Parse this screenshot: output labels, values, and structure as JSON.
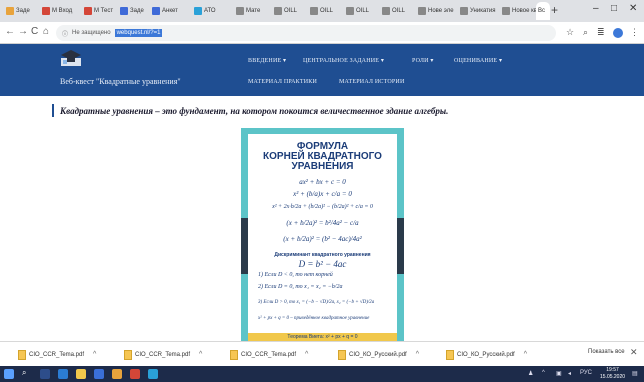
{
  "browser": {
    "tabs": [
      {
        "label": "Заде",
        "color": "#e8a33c"
      },
      {
        "label": "M Вход",
        "color": "#d44638"
      },
      {
        "label": "M Тест",
        "color": "#d44638"
      },
      {
        "label": "Заде",
        "color": "#3f6ad8"
      },
      {
        "label": "Анкет",
        "color": "#3f6ad8"
      },
      {
        "label": "АТО",
        "color": "#2aa1d8"
      },
      {
        "label": "Мате",
        "color": "#888888"
      },
      {
        "label": "OILL",
        "color": "#888888"
      },
      {
        "label": "OILL",
        "color": "#888888"
      },
      {
        "label": "OILL",
        "color": "#888888"
      },
      {
        "label": "OILL",
        "color": "#888888"
      },
      {
        "label": "Нове эле",
        "color": "#888888"
      },
      {
        "label": "Уникатия",
        "color": "#888888"
      },
      {
        "label": "Новое кв",
        "color": "#888888"
      },
      {
        "label": "Вс",
        "color": "#888888"
      }
    ],
    "new_tab": "+",
    "minimize": "–",
    "maximize": "□",
    "close": "✕",
    "back": "←",
    "forward": "→",
    "reload": "C",
    "home": "⌂",
    "security_label": "Не защищено",
    "url": "webquest.nl/?=1"
  },
  "site": {
    "title": "Веб-квест \"Квадратные уравнения\"",
    "nav": {
      "intro": "ВВЕДЕНИЕ ▾",
      "central_task": "ЦЕНТРАЛЬНОЕ ЗАДАНИЕ ▾",
      "roles": "РОЛИ ▾",
      "evaluation": "ОЦЕНИВАНИЕ ▾",
      "practice": "МАТЕРИАЛ ПРАКТИКИ",
      "history": "МАТЕРИАЛ ИСТОРИИ"
    },
    "quote": "Квадратные уравнения – это фундамент, на котором покоится величественное здание алгебры."
  },
  "poster": {
    "title_line1": "ФОРМУЛА",
    "title_line2": "КОРНЕЙ КВАДРАТНОГО",
    "title_line3": "УРАВНЕНИЯ",
    "eq1": "ax² + bx + c = 0",
    "eq2": "x² + (b/a)x + c/a = 0",
    "eq3": "x² + 2x·b/2a + (b/2a)² − (b/2a)² + c/a = 0",
    "eq4": "(x + b/2a)² = b²/4a² − c/a",
    "eq5": "(x + b/2a)² = (b² − 4ac)/4a²",
    "disc_label": "Дискриминант квадратного уравнения",
    "disc_formula": "D = b² − 4ac",
    "case1": "1) Если D < 0, то нет корней",
    "case2": "2) Если D = 0, то x₁ = x₂ = −b/2a",
    "case3": "3) Если D > 0, то x₁ = (−b − √D)/2a,  x₂ = (−b + √D)/2a",
    "reduced": "x² + px + q = 0 – приведённое квадратное уравнение",
    "bottom": "Теорема Виета: x² + px + q = 0"
  },
  "downloads": {
    "items": [
      "CIO_CCR_Tema.pdf",
      "CIO_CCR_Tema.pdf",
      "CIO_CCR_Tema.pdf",
      "CIO_КО_Русский.pdf",
      "CIO_КО_Русский.pdf"
    ],
    "show_all": "Показать все",
    "close": "✕"
  },
  "taskbar": {
    "time": "19:57",
    "date": "15.05.2020",
    "lang": "РУС"
  }
}
